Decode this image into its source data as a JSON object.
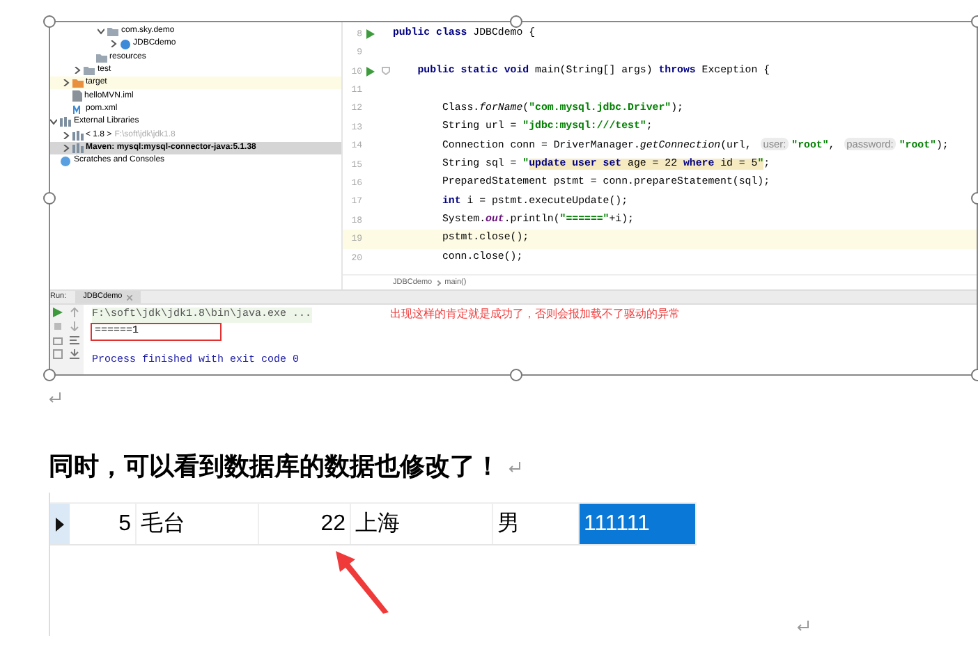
{
  "ide": {
    "tree": [
      {
        "children": [
          {
            "children": [
              {
                "children": [
                  {
                    "children": [
                      {
                        "label": "com.sky.demo",
                        "kind": "package",
                        "expanded": true,
                        "selected": false,
                        "children": [
                          {
                            "label": "JDBCdemo",
                            "kind": "class",
                            "expanded": false,
                            "selected": false
                          }
                        ]
                      }
                    ]
                  },
                  {
                    "label": "resources",
                    "kind": "folder",
                    "selected": false
                  }
                ]
              },
              {
                "label": "test",
                "kind": "folder",
                "expanded": false,
                "selected": false
              }
            ]
          },
          {
            "label": "target",
            "kind": "excluded-folder",
            "expanded": false,
            "selected": false
          },
          {
            "label": "helloMVN.iml",
            "kind": "file",
            "selected": false
          },
          {
            "label": "pom.xml",
            "kind": "maven",
            "selected": false
          }
        ]
      },
      {
        "label": "External Libraries",
        "kind": "library",
        "expanded": true,
        "selected": false,
        "children": [
          {
            "label": "< 1.8 >",
            "path": "F:\\soft\\jdk\\jdk1.8",
            "kind": "jdk",
            "expanded": false,
            "selected": false
          },
          {
            "label": "Maven: mysql:mysql-connector-java:5.1.38",
            "kind": "library",
            "expanded": false,
            "selected": true
          }
        ]
      },
      {
        "label": "Scratches and Consoles",
        "kind": "scratches",
        "selected": false
      }
    ],
    "code": [
      {
        "number": "8",
        "run": true,
        "fold": false,
        "current": false,
        "tokens": [
          {
            "kind": "keyword",
            "text": "public class "
          },
          {
            "kind": "plain",
            "text": "JDBCdemo {"
          }
        ]
      },
      {
        "number": "9",
        "run": false,
        "fold": false,
        "current": false
      },
      {
        "number": "10",
        "run": true,
        "fold": true,
        "current": false,
        "tokens": [
          {
            "kind": "keyword",
            "text": "    public static void "
          },
          {
            "kind": "plain",
            "text": "main(String[] args) "
          },
          {
            "kind": "keyword",
            "text": "throws "
          },
          {
            "kind": "plain",
            "text": "Exception {"
          }
        ]
      },
      {
        "number": "11",
        "run": false,
        "fold": false,
        "current": false
      },
      {
        "number": "12",
        "run": false,
        "fold": false,
        "current": false,
        "tokens": [
          {
            "kind": "plain",
            "text": "        Class."
          },
          {
            "kind": "italic",
            "text": "forName"
          },
          {
            "kind": "plain",
            "text": "("
          },
          {
            "kind": "string",
            "text": "\"com.mysql.jdbc.Driver\""
          },
          {
            "kind": "plain",
            "text": ");"
          }
        ]
      },
      {
        "number": "13",
        "run": false,
        "fold": false,
        "current": false,
        "tokens": [
          {
            "kind": "plain",
            "text": "        String url = "
          },
          {
            "kind": "string",
            "text": "\"jdbc:mysql:///test\""
          },
          {
            "kind": "plain",
            "text": ";"
          }
        ]
      },
      {
        "number": "14",
        "run": false,
        "fold": false,
        "current": false,
        "tokens": [
          {
            "kind": "plain",
            "text": "        Connection conn = DriverManager."
          },
          {
            "kind": "italic",
            "text": "getConnection"
          },
          {
            "kind": "plain",
            "text": "(url, "
          },
          {
            "kind": "hint",
            "text": "user:"
          },
          {
            "kind": "string",
            "text": "\"root\""
          },
          {
            "kind": "plain",
            "text": ", "
          },
          {
            "kind": "hint",
            "text": "password:"
          },
          {
            "kind": "string",
            "text": "\"root\""
          },
          {
            "kind": "plain",
            "text": ");"
          }
        ]
      },
      {
        "number": "15",
        "run": false,
        "fold": false,
        "current": false,
        "tokens": [
          {
            "kind": "plain",
            "text": "        String sql = "
          },
          {
            "kind": "string",
            "text": "\""
          },
          {
            "kind": "sql-keyword",
            "text": "update user set"
          },
          {
            "kind": "sql",
            "text": " age = 22 "
          },
          {
            "kind": "sql-keyword",
            "text": "where"
          },
          {
            "kind": "sql",
            "text": " id = 5"
          },
          {
            "kind": "sql-string",
            "text": "\""
          },
          {
            "kind": "plain",
            "text": ";"
          }
        ]
      },
      {
        "number": "16",
        "run": false,
        "fold": false,
        "current": false,
        "tokens": [
          {
            "kind": "plain",
            "text": "        PreparedStatement pstmt = conn.prepareStatement(sql);"
          }
        ]
      },
      {
        "number": "17",
        "run": false,
        "fold": false,
        "current": false,
        "tokens": [
          {
            "kind": "keyword",
            "text": "        int "
          },
          {
            "kind": "plain",
            "text": "i = pstmt.executeUpdate();"
          }
        ]
      },
      {
        "number": "18",
        "run": false,
        "fold": false,
        "current": false,
        "tokens": [
          {
            "kind": "plain",
            "text": "        System."
          },
          {
            "kind": "field",
            "text": "out"
          },
          {
            "kind": "plain",
            "text": ".println("
          },
          {
            "kind": "string",
            "text": "\"======\""
          },
          {
            "kind": "plain",
            "text": "+i);"
          }
        ]
      },
      {
        "number": "19",
        "run": false,
        "fold": false,
        "current": true,
        "tokens": [
          {
            "kind": "plain",
            "text": "        pstmt.close();"
          }
        ]
      },
      {
        "number": "20",
        "run": false,
        "fold": false,
        "current": false,
        "tokens": [
          {
            "kind": "plain",
            "text": "        conn.close();"
          }
        ]
      }
    ],
    "breadcrumb": [
      "JDBCdemo",
      "main()"
    ],
    "run_label": "Run:",
    "run_tabs": [
      {
        "label": "JDBCdemo",
        "selected": true
      }
    ],
    "console": [
      {
        "kind": "command",
        "text": "F:\\soft\\jdk\\jdk1.8\\bin\\java.exe ...",
        "boxed": false
      },
      {
        "kind": "output",
        "text": "======1",
        "boxed": true
      },
      {
        "kind": "exit",
        "text": "Process finished with exit code 0",
        "boxed": false
      }
    ],
    "note": "出现这样的肯定就是成功了，否则会报加载不了驱动的异常"
  },
  "heading": "同时，可以看到数据库的数据也修改了！",
  "table": {
    "rows": [
      {
        "current": true,
        "cells": [
          {
            "text": "5",
            "selected": false
          },
          {
            "text": "毛台",
            "selected": false
          },
          {
            "text": "22",
            "selected": false
          },
          {
            "text": "上海",
            "selected": false
          },
          {
            "text": "男",
            "selected": false
          },
          {
            "text": "111111",
            "selected": true
          }
        ]
      }
    ]
  }
}
